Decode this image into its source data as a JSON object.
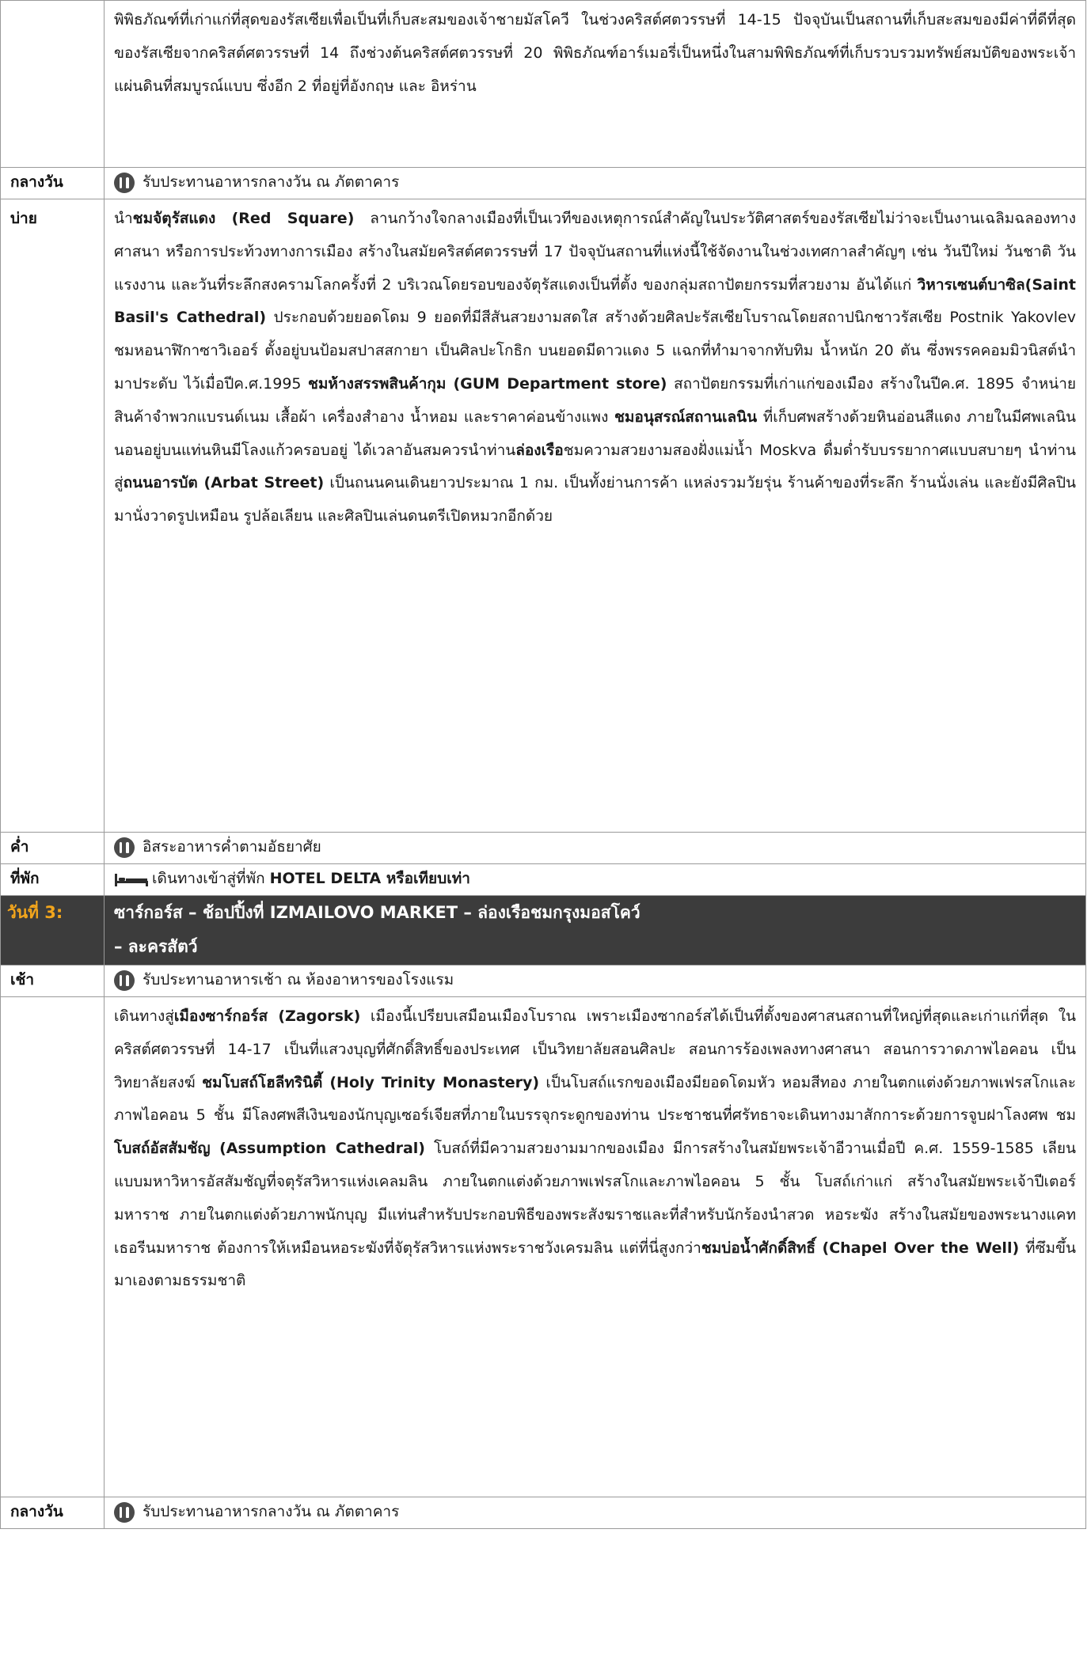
{
  "rows": {
    "r0": {
      "text": "พิพิธภัณฑ์ที่เก่าแก่ที่สุดของรัสเซียเพื่อเป็นที่เก็บสะสมของเจ้าชายมัสโควี ในช่วงคริสต์ศตวรรษที่ 14-15 ปัจจุบันเป็นสถานที่เก็บสะสมของมีค่าที่ดีที่สุดของรัสเซียจากคริสต์ศตวรรษที่ 14 ถึงช่วงต้นคริสต์ศตวรรษที่ 20 พิพิธภัณฑ์อาร์เมอรี่เป็นหนึ่งในสามพิพิธภัณฑ์ที่เก็บรวบรวมทรัพย์สมบัติของพระเจ้าแผ่นดินที่สมบูรณ์แบบ ซึ่งอีก 2 ที่อยู่ที่อังกฤษ และ อิหร่าน"
    },
    "r1": {
      "label": "กลางวัน",
      "icon": "meal-icon",
      "text": "รับประทานอาหารกลางวัน ณ ภัตตาคาร"
    },
    "r2": {
      "label": "บ่าย",
      "t1": "นำ",
      "b1": "ชมจัตุรัสแดง (Red Square)",
      "t2": " ลานกว้างใจกลางเมืองที่เป็นเวทีของเหตุการณ์สำคัญในประวัติศาสตร์ของรัสเซียไม่ว่าจะเป็นงานเฉลิมฉลองทางศาสนา หรือการประท้วงทางการเมือง สร้างในสมัยคริสต์ศตวรรษที่ 17 ปัจจุบันสถานที่แห่งนี้ใช้จัดงานในช่วงเทศกาลสำคัญๆ เช่น วันปีใหม่ วันชาติ วันแรงงาน และวันที่ระลึกสงครามโลกครั้งที่ 2 บริเวณโดยรอบของจัตุรัสแดงเป็นที่ตั้ง ของกลุ่มสถาปัตยกรรมที่สวยงาม อันได้แก่ ",
      "b2": "วิหารเซนต์บาซิล(Saint Basil's Cathedral)",
      "t3": " ประกอบด้วยยอดโดม 9 ยอดที่มีสีสันสวยงามสดใส สร้างด้วยศิลปะรัสเซียโบราณโดยสถาปนิกชาวรัสเซีย Postnik Yakovlev ชมหอนาฬิกาซาวิเออร์ ตั้งอยู่บนป้อมสปาสสกายา เป็นศิลปะโกธิก บนยอดมีดาวแดง 5 แฉกที่ทำมาจากทับทิม น้ำหนัก 20 ตัน ซึ่งพรรคคอมมิวนิสต์นำมาประดับ ไว้เมื่อปีค.ศ.1995 ",
      "b3": "ชมห้างสรรพสินค้ากุม (GUM Department store)",
      "t4": " สถาปัตยกรรมที่เก่าแก่ของเมือง สร้างในปีค.ศ. 1895 จำหน่ายสินค้าจำพวกแบรนด์เนม เสื้อผ้า เครื่องสำอาง น้ำหอม และราคาค่อนข้างแพง ",
      "b4": "ชมอนุสรณ์สถานเลนิน",
      "t5": " ที่เก็บศพสร้างด้วยหินอ่อนสีแดง ภายในมีศพเลนินนอนอยู่บนแท่นหินมีโลงแก้วครอบอยู่ ได้เวลาอันสมควรนำท่าน",
      "b5": "ล่องเรือ",
      "t6": "ชมความสวยงามสองฝั่งแม่น้ำ Moskva ดื่มด่ำรับบรรยากาศแบบสบายๆ นำท่านสู่",
      "b6": "ถนนอารบัต (Arbat Street)",
      "t7": " เป็นถนนคนเดินยาวประมาณ 1 กม. เป็นทั้งย่านการค้า แหล่งรวมวัยรุ่น ร้านค้าของที่ระลึก ร้านนั่งเล่น และยังมีศิลปินมานั่งวาดรูปเหมือน รูปล้อเลียน และศิลปินเล่นดนตรีเปิดหมวกอีกด้วย"
    },
    "r3": {
      "label": "ค่ำ",
      "icon": "meal-icon",
      "text": "อิสระอาหารค่ำตามอัธยาศัย"
    },
    "r4": {
      "label": "ที่พัก",
      "icon": "bed-icon",
      "t1": "เดินทางเข้าสู่ที่พัก ",
      "b1": "HOTEL DELTA หรือเทียบเท่า"
    },
    "r5": {
      "label": "วันที่ 3:",
      "line1": "ซาร์กอร์ส – ช้อปปิ้งที่  IZMAILOVO MARKET – ล่องเรือชมกรุงมอสโคว์",
      "line2": "– ละครสัตว์"
    },
    "r6": {
      "label": "เช้า",
      "icon": "meal-icon",
      "text": "รับประทานอาหารเช้า ณ ห้องอาหารของโรงแรม"
    },
    "r7": {
      "t1": "เดินทางสู่",
      "b1": "เมืองซาร์กอร์ส (Zagorsk)",
      "t2": " เมืองนี้เปรียบเสมือนเมืองโบราณ เพราะเมืองซากอร์สได้เป็นที่ตั้งของศาสนสถานที่ใหญ่ที่สุดและเก่าแก่ที่สุด ในคริสต์ศตวรรษที่ 14-17 เป็นที่แสวงบุญที่ศักดิ์สิทธิ์ของประเทศ เป็นวิทยาลัยสอนศิลปะ สอนการร้องเพลงทางศาสนา สอนการวาดภาพไอคอน เป็นวิทยาลัยสงฆ์ ",
      "b2": "ชมโบสถ์โฮลีทรินิตี้ (Holy Trinity Monastery)",
      "t3": " เป็นโบสถ์แรกของเมืองมียอดโดมหัว หอมสีทอง ภายในตกแต่งด้วยภาพเฟรสโกและภาพไอคอน 5 ชั้น มีโลงศพสีเงินของนักบุญเซอร์เจียสที่ภายในบรรจุกระดูกของท่าน ประชาชนที่ศรัทธาจะเดินทางมาสักการะด้วยการจูบฝาโลงศพ ชม",
      "b3": "โบสถ์อัสสัมชัญ (Assumption Cathedral)",
      "t4": " โบสถ์ที่มีความสวยงามมากของเมือง มีการสร้างในสมัยพระเจ้าอีวานเมื่อปี ค.ศ. 1559-1585 เลียนแบบมหาวิหารอัสสัมชัญที่จตุรัสวิหารแห่งเคลมลิน ภายในตกแต่งด้วยภาพเฟรสโกและภาพไอคอน 5 ชั้น โบสถ์เก่าแก่ สร้างในสมัยพระเจ้าปีเตอร์มหาราช ภายในตกแต่งด้วยภาพนักบุญ มีแท่นสำหรับประกอบพิธีของพระสังฆราชและที่สำหรับนักร้องนำสวด หอระฆัง สร้างในสมัยของพระนางแคทเธอรีนมหาราช ต้องการให้เหมือนหอระฆังที่จัตุรัสวิหารแห่งพระราชวังเครมลิน แต่ที่นี่สูงกว่า",
      "b4": "ชมบ่อน้ำศักดิ์สิทธิ์ (Chapel Over the Well)",
      "t5": " ที่ซึมขึ้นมาเองตามธรรมชาติ"
    },
    "r8": {
      "label": "กลางวัน",
      "icon": "meal-icon",
      "text": "รับประทานอาหารกลางวัน ณ ภัตตาคาร"
    }
  },
  "colors": {
    "day_bar_bg": "#3c3c3c",
    "day_label": "#f2a51c",
    "border": "#9a9a9a"
  }
}
